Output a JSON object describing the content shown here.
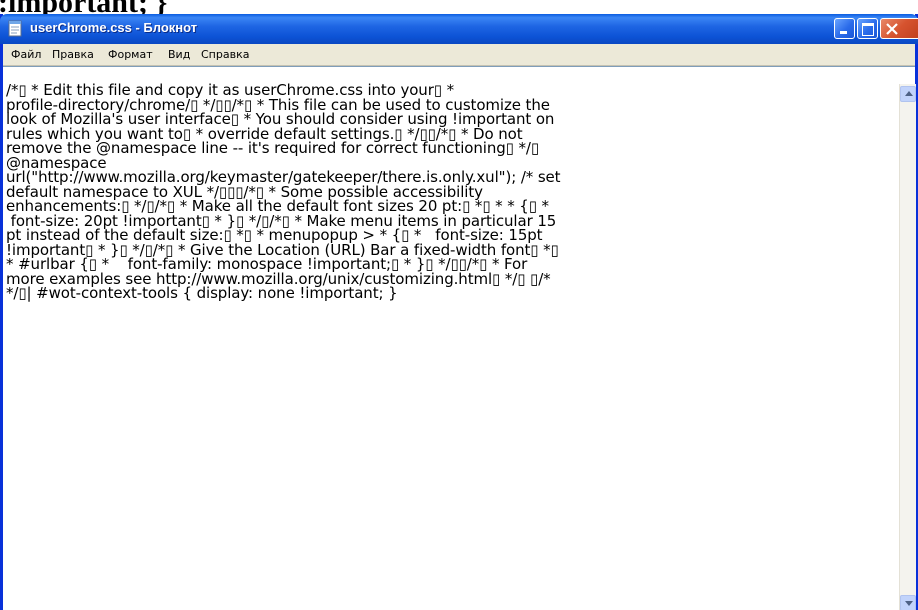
{
  "background": {
    "clipped_text": ":important; }"
  },
  "window": {
    "title": "userChrome.css - Блокнот",
    "buttons": {
      "minimize": "minimize",
      "maximize": "maximize",
      "close": "close"
    }
  },
  "menu": {
    "items": [
      "Файл",
      "Правка",
      "Формат",
      "Вид",
      "Справка"
    ]
  },
  "editor": {
    "lines": [
      "/*▯ * Edit this file and copy it as userChrome.css into your▯ *",
      "profile-directory/chrome/▯ */▯▯/*▯ * This file can be used to customize the",
      "look of Mozilla's user interface▯ * You should consider using !important on",
      "rules which you want to▯ * override default settings.▯ */▯▯/*▯ * Do not",
      "remove the @namespace line -- it's required for correct functioning▯ */▯",
      "@namespace",
      "url(\"http://www.mozilla.org/keymaster/gatekeeper/there.is.only.xul\"); /* set",
      "default namespace to XUL */▯▯▯/*▯ * Some possible accessibility",
      "enhancements:▯ */▯/*▯ * Make all the default font sizes 20 pt:▯ *▯ * * {▯ *",
      " font-size: 20pt !important▯ * }▯ */▯/*▯ * Make menu items in particular 15",
      "pt instead of the default size:▯ *▯ * menupopup > * {▯ *   font-size: 15pt",
      "!important▯ * }▯ */▯/*▯ * Give the Location (URL) Bar a fixed-width font▯ *▯",
      "* #urlbar {▯ *    font-family: monospace !important;▯ * }▯ */▯▯/*▯ * For",
      "more examples see http://www.mozilla.org/unix/customizing.html▯ */▯ ▯/*",
      "*/▯| #wot-context-tools { display: none !important; }"
    ]
  },
  "colors": {
    "titlebar": "#0d53d6",
    "window_border": "#0831d9",
    "menubar": "#ece9d8",
    "close_button": "#d6532f"
  }
}
